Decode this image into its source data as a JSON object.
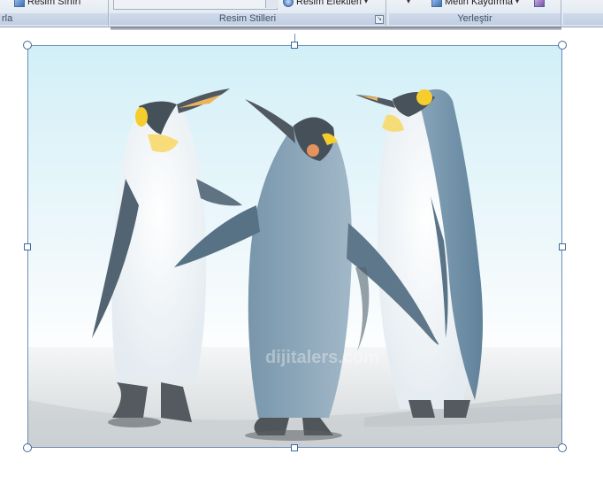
{
  "ribbon": {
    "groups": [
      {
        "label": "rla"
      },
      {
        "label": "Resim Stilleri"
      },
      {
        "label": "Yerleştir"
      }
    ],
    "buttons": {
      "picture_border": "Resim Sınırı",
      "picture_effects": "Resim Efektleri",
      "text_wrapping": "Metin Kaydırma"
    },
    "dropdown_glyph": "▾",
    "launcher_glyph": "↘"
  },
  "picture": {
    "watermark": "dijitalers.com",
    "state": "selected"
  },
  "colors": {
    "selection": "#3f6a9c",
    "ribbon_label": "#c1cfe2"
  }
}
